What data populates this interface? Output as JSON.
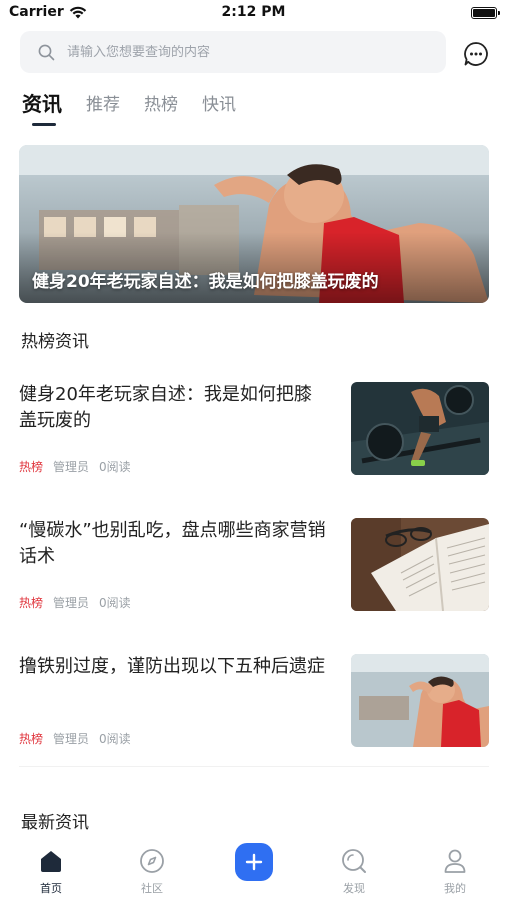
{
  "status_bar": {
    "carrier": "Carrier",
    "time": "2:12 PM"
  },
  "search": {
    "placeholder": "请输入您想要查询的内容"
  },
  "icons": {
    "search": "search-icon",
    "message": "message-icon",
    "home": "home-icon",
    "community": "compass-icon",
    "add": "plus-icon",
    "discover": "discover-icon",
    "profile": "person-icon"
  },
  "colors": {
    "accent": "#2f6ff2",
    "hot_tag": "#e0353d",
    "active_tab": "#1e2a3a"
  },
  "tabs": [
    {
      "label": "资讯",
      "active": true
    },
    {
      "label": "推荐",
      "active": false
    },
    {
      "label": "热榜",
      "active": false
    },
    {
      "label": "快讯",
      "active": false
    }
  ],
  "banner": {
    "title": "健身20年老玩家自述：我是如何把膝盖玩废的"
  },
  "hot_section": {
    "title": "热榜资讯"
  },
  "articles": [
    {
      "title": "健身20年老玩家自述：我是如何把膝盖玩废的",
      "tag": "热榜",
      "author": "管理员",
      "reads": "0阅读"
    },
    {
      "title": "“慢碳水”也别乱吃，盘点哪些商家营销话术",
      "tag": "热榜",
      "author": "管理员",
      "reads": "0阅读"
    },
    {
      "title": "撸铁别过度，谨防出现以下五种后遗症",
      "tag": "热榜",
      "author": "管理员",
      "reads": "0阅读"
    }
  ],
  "latest_section": {
    "title": "最新资讯"
  },
  "tab_bar": [
    {
      "label": "首页",
      "active": true
    },
    {
      "label": "社区",
      "active": false
    },
    {
      "label": "发现",
      "active": false
    },
    {
      "label": "我的",
      "active": false
    }
  ]
}
